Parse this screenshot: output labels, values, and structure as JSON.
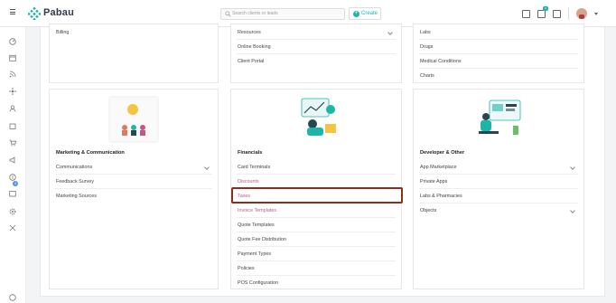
{
  "brand": {
    "name": "Pabau"
  },
  "header": {
    "search_placeholder": "Search clients or leads",
    "create_label": "Create",
    "notification_count": "9"
  },
  "sidebar": {
    "badge_count": "4"
  },
  "columns": {
    "left_top": {
      "items": [
        "Billing"
      ]
    },
    "middle_top": {
      "items": [
        "Resources",
        "Online Booking",
        "Client Portal"
      ]
    },
    "right_top": {
      "items": [
        "Labs",
        "Drugs",
        "Medical Conditions",
        "Charts"
      ]
    },
    "marketing": {
      "title": "Marketing & Communication",
      "items": [
        "Communications",
        "Feedback Survey",
        "Marketing Sources"
      ]
    },
    "financials": {
      "title": "Financials",
      "items": [
        "Card Terminals",
        "Discounts",
        "Taxes",
        "Invoice Templates",
        "Quote Templates",
        "Quote Fee Distribution",
        "Payment Types",
        "Policies",
        "POS Configuration"
      ]
    },
    "developer": {
      "title": "Developer & Other",
      "items": [
        "App Marketplace",
        "Private Apps",
        "Labs & Pharmacies",
        "Objects"
      ]
    }
  },
  "colors": {
    "accent": "#1db5a8",
    "link_pink": "#c2578a",
    "highlight": "#8b2e1d"
  }
}
